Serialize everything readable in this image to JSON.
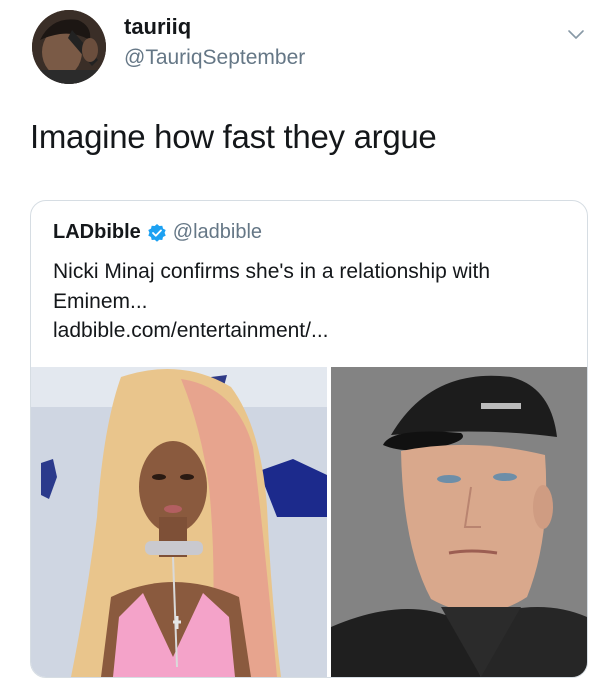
{
  "tweet": {
    "author": {
      "display_name": "tauriiq",
      "handle": "@TauriqSeptember"
    },
    "text": "Imagine how fast they argue",
    "menu_icon": "chevron-down-icon"
  },
  "quoted_tweet": {
    "author": {
      "display_name": "LADbible",
      "handle": "@ladbible",
      "verified_icon": "verified-badge-icon"
    },
    "text": "Nicki Minaj confirms she's in a relationship with Eminem...",
    "link": "ladbible.com/entertainment/...",
    "media": [
      {
        "name": "photo-left"
      },
      {
        "name": "photo-right"
      }
    ]
  },
  "colors": {
    "text_primary": "#14171a",
    "text_secondary": "#657786",
    "verified_blue": "#1da1f2",
    "card_border": "#d6dde3"
  }
}
